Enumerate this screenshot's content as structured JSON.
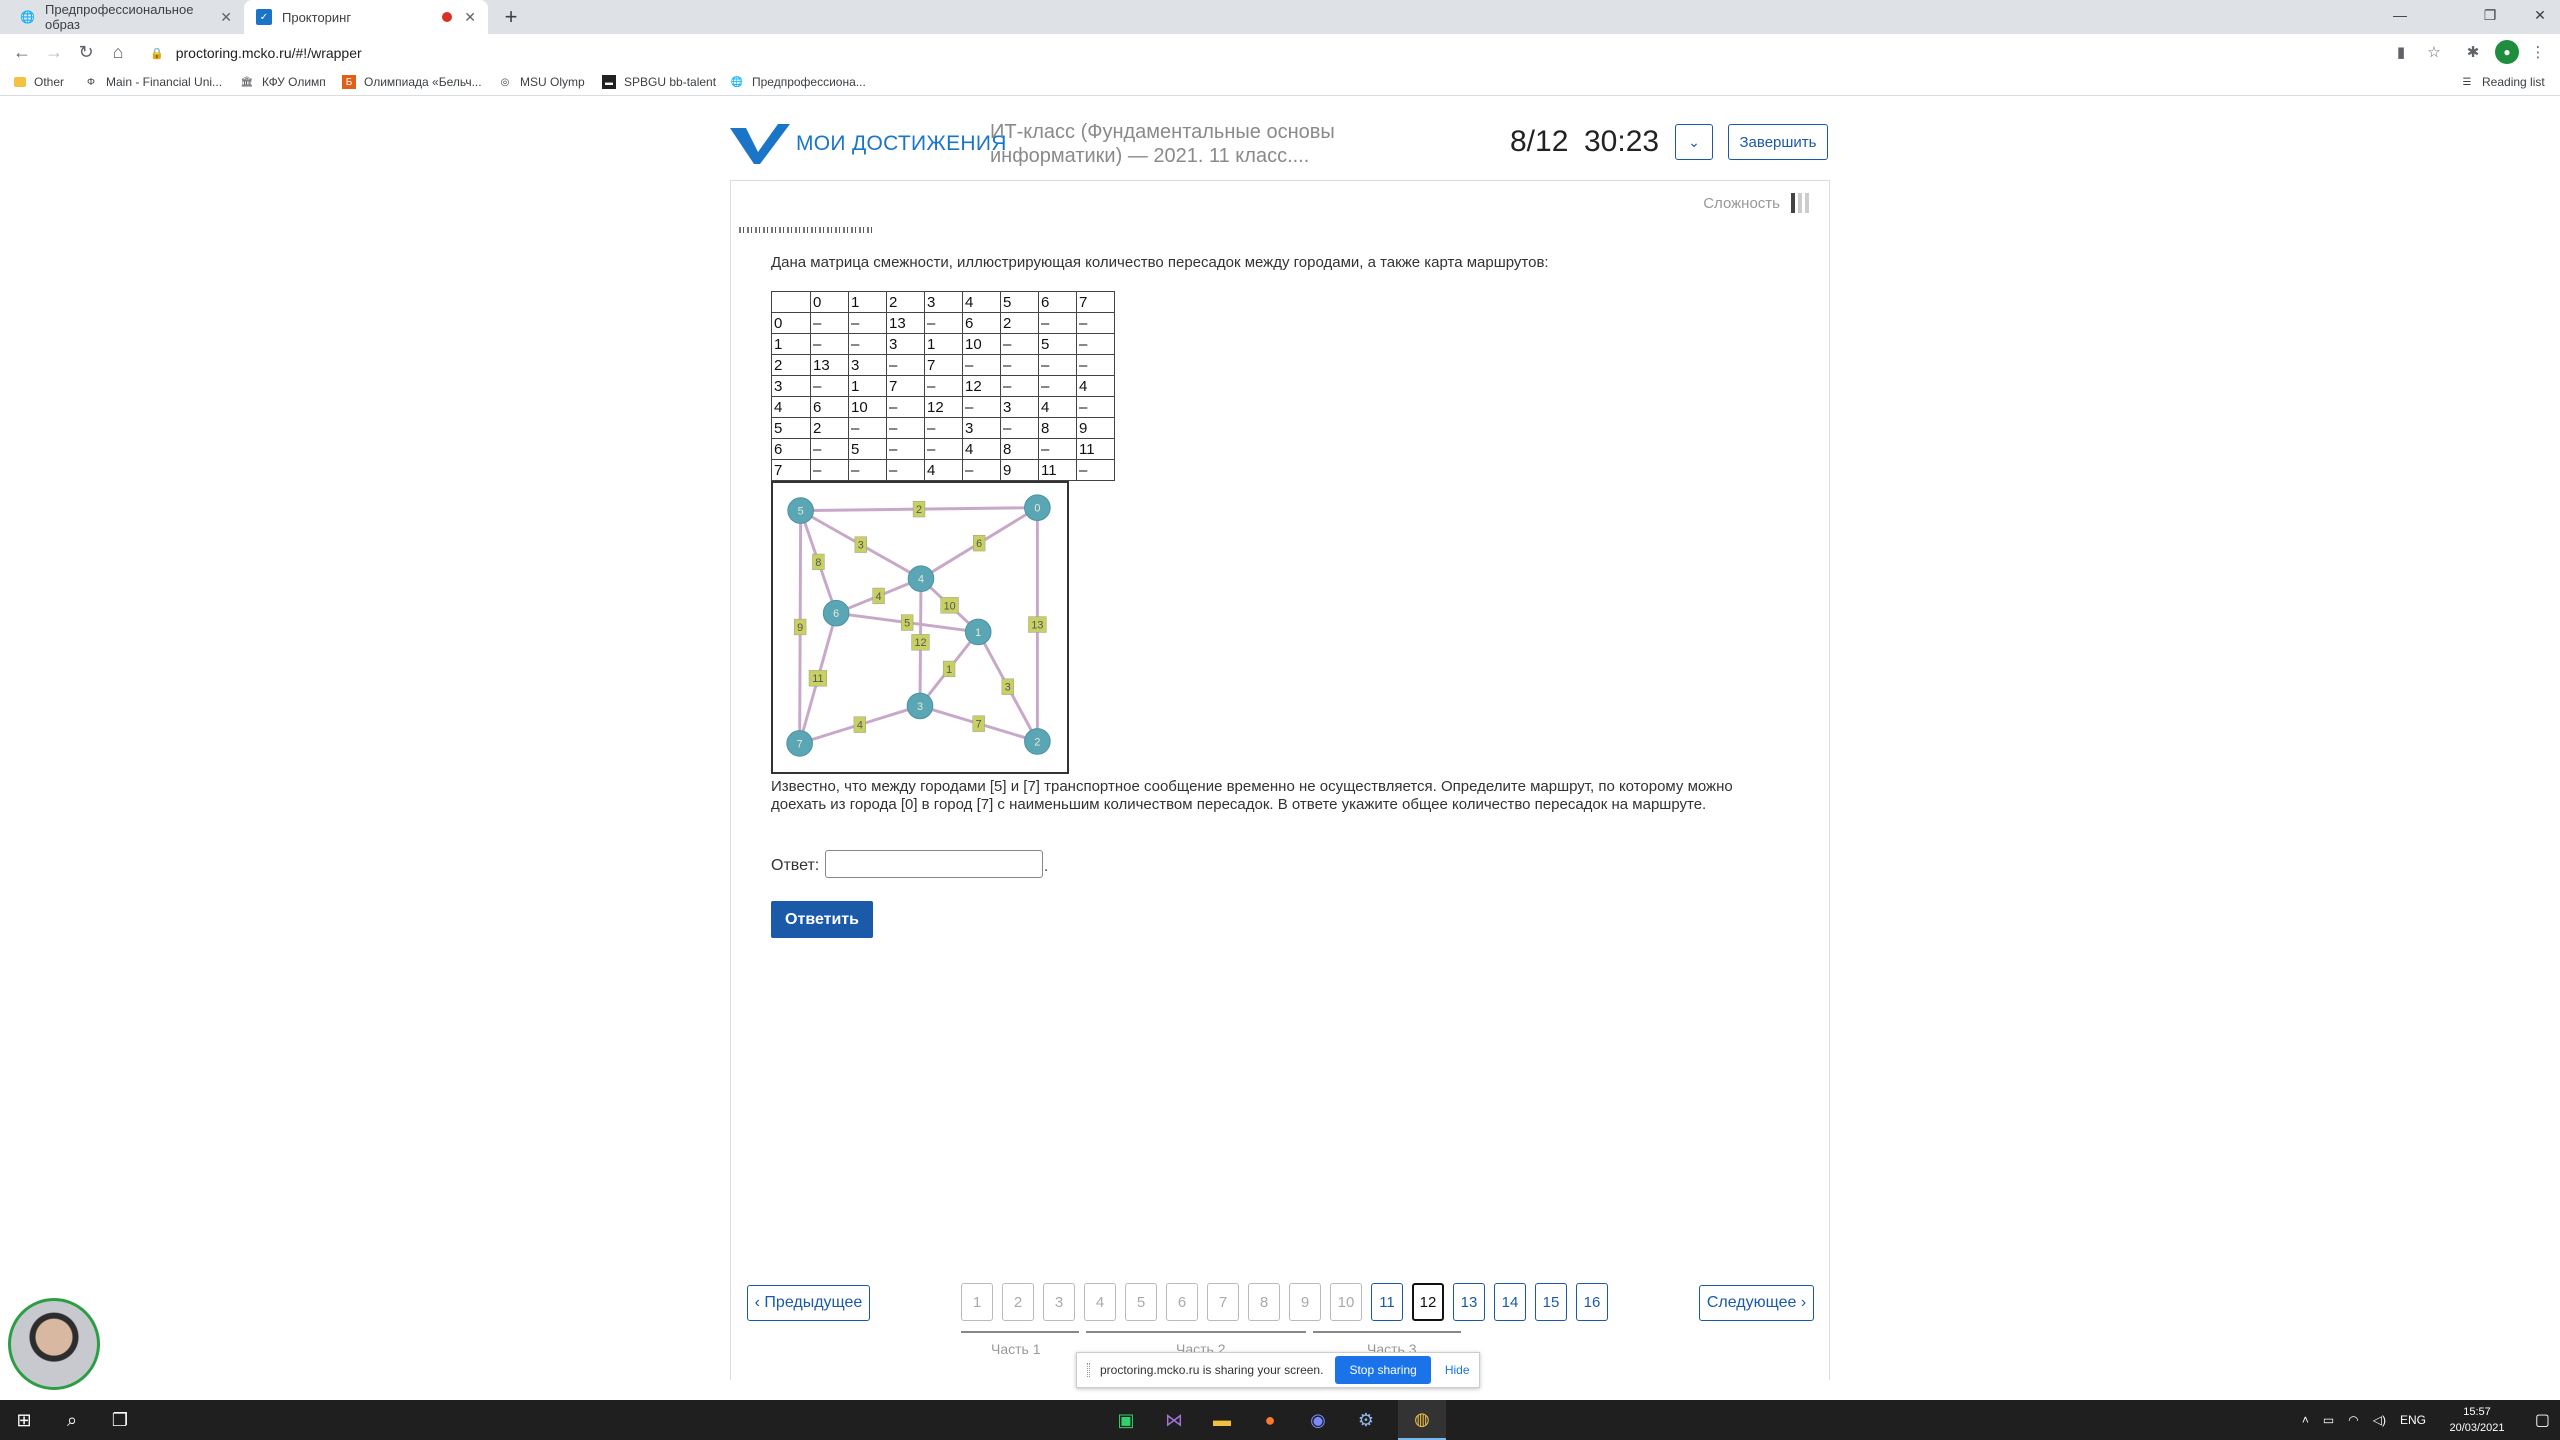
{
  "browser": {
    "tabs": [
      {
        "label": "Предпрофессиональное образ"
      },
      {
        "label": "Прокторинг"
      }
    ],
    "url": "proctoring.mcko.ru/#!/wrapper",
    "bookmarks": [
      "Other",
      "Main - Financial Uni...",
      "КФУ Олимп",
      "Олимпиада «Бельч...",
      "MSU Olymp",
      "SPBGU bb-talent",
      "Предпрофессиона..."
    ],
    "reading_list": "Reading list"
  },
  "header": {
    "logo_text": "МОИ ДОСТИЖЕНИЯ",
    "test_title": "ИТ-класс (Фундаментальные основы информатики) — 2021. 11 класс....",
    "progress": "8/12",
    "timer": "30:23",
    "finish_label": "Завершить",
    "accent_color": "#1a5aa8"
  },
  "question": {
    "difficulty_label": "Сложность",
    "difficulty_level": 1,
    "difficulty_max": 3,
    "intro": "Дана матрица смежности, иллюстрирующая количество пересадок между городами, а также карта маршрутов:",
    "matrix": [
      [
        "",
        "0",
        "1",
        "2",
        "3",
        "4",
        "5",
        "6",
        "7"
      ],
      [
        "0",
        "–",
        "–",
        "13",
        "–",
        "6",
        "2",
        "–",
        "–"
      ],
      [
        "1",
        "–",
        "–",
        "3",
        "1",
        "10",
        "–",
        "5",
        "–"
      ],
      [
        "2",
        "13",
        "3",
        "–",
        "7",
        "–",
        "–",
        "–",
        "–"
      ],
      [
        "3",
        "–",
        "1",
        "7",
        "–",
        "12",
        "–",
        "–",
        "4"
      ],
      [
        "4",
        "6",
        "10",
        "–",
        "12",
        "–",
        "3",
        "4",
        "–"
      ],
      [
        "5",
        "2",
        "–",
        "–",
        "–",
        "3",
        "–",
        "8",
        "9"
      ],
      [
        "6",
        "–",
        "5",
        "–",
        "–",
        "4",
        "8",
        "–",
        "11"
      ],
      [
        "7",
        "–",
        "–",
        "–",
        "4",
        "–",
        "9",
        "11",
        "–"
      ]
    ],
    "graph": {
      "nodes": [
        "5",
        "0",
        "4",
        "6",
        "1",
        "3",
        "7",
        "2"
      ],
      "edges": [
        {
          "from": "5",
          "to": "0",
          "w": "2"
        },
        {
          "from": "0",
          "to": "4",
          "w": "6"
        },
        {
          "from": "5",
          "to": "4",
          "w": "3"
        },
        {
          "from": "5",
          "to": "6",
          "w": "8"
        },
        {
          "from": "5",
          "to": "7",
          "w": "9"
        },
        {
          "from": "6",
          "to": "4",
          "w": "4"
        },
        {
          "from": "6",
          "to": "1",
          "w": "5"
        },
        {
          "from": "4",
          "to": "1",
          "w": "10"
        },
        {
          "from": "4",
          "to": "3",
          "w": "12"
        },
        {
          "from": "6",
          "to": "7",
          "w": "11"
        },
        {
          "from": "0",
          "to": "2",
          "w": "13"
        },
        {
          "from": "1",
          "to": "3",
          "w": "1"
        },
        {
          "from": "1",
          "to": "2",
          "w": "3"
        },
        {
          "from": "7",
          "to": "3",
          "w": "4"
        },
        {
          "from": "3",
          "to": "2",
          "w": "7"
        }
      ],
      "node_color": "#5aa6b5",
      "edge_color": "#c8a8c8",
      "label_color": "#c8d060"
    },
    "text": "Известно, что между городами [5] и [7] транспортное сообщение временно не осуществляется. Определите маршрут, по которому можно доехать из города [0] в город [7] с наименьшим количеством пересадок. В ответе укажите общее количество пересадок на маршруте.",
    "answer_label": "Ответ:",
    "answer_value": "",
    "answer_suffix": ".",
    "submit_label": "Ответить"
  },
  "pagination": {
    "prev_label": "‹ Предыдущее",
    "next_label": "Следующее ›",
    "pages": [
      "1",
      "2",
      "3",
      "4",
      "5",
      "6",
      "7",
      "8",
      "9",
      "10",
      "11",
      "12",
      "13",
      "14",
      "15",
      "16"
    ],
    "current": "12",
    "available": [
      "11",
      "13",
      "14",
      "15",
      "16"
    ],
    "parts": [
      "Часть 1",
      "Часть 2",
      "Часть 3"
    ]
  },
  "share_bar": {
    "text": "proctoring.mcko.ru is sharing your screen.",
    "stop_label": "Stop sharing",
    "hide_label": "Hide"
  },
  "taskbar": {
    "lang": "ENG",
    "time": "15:57",
    "date": "20/03/2021"
  }
}
